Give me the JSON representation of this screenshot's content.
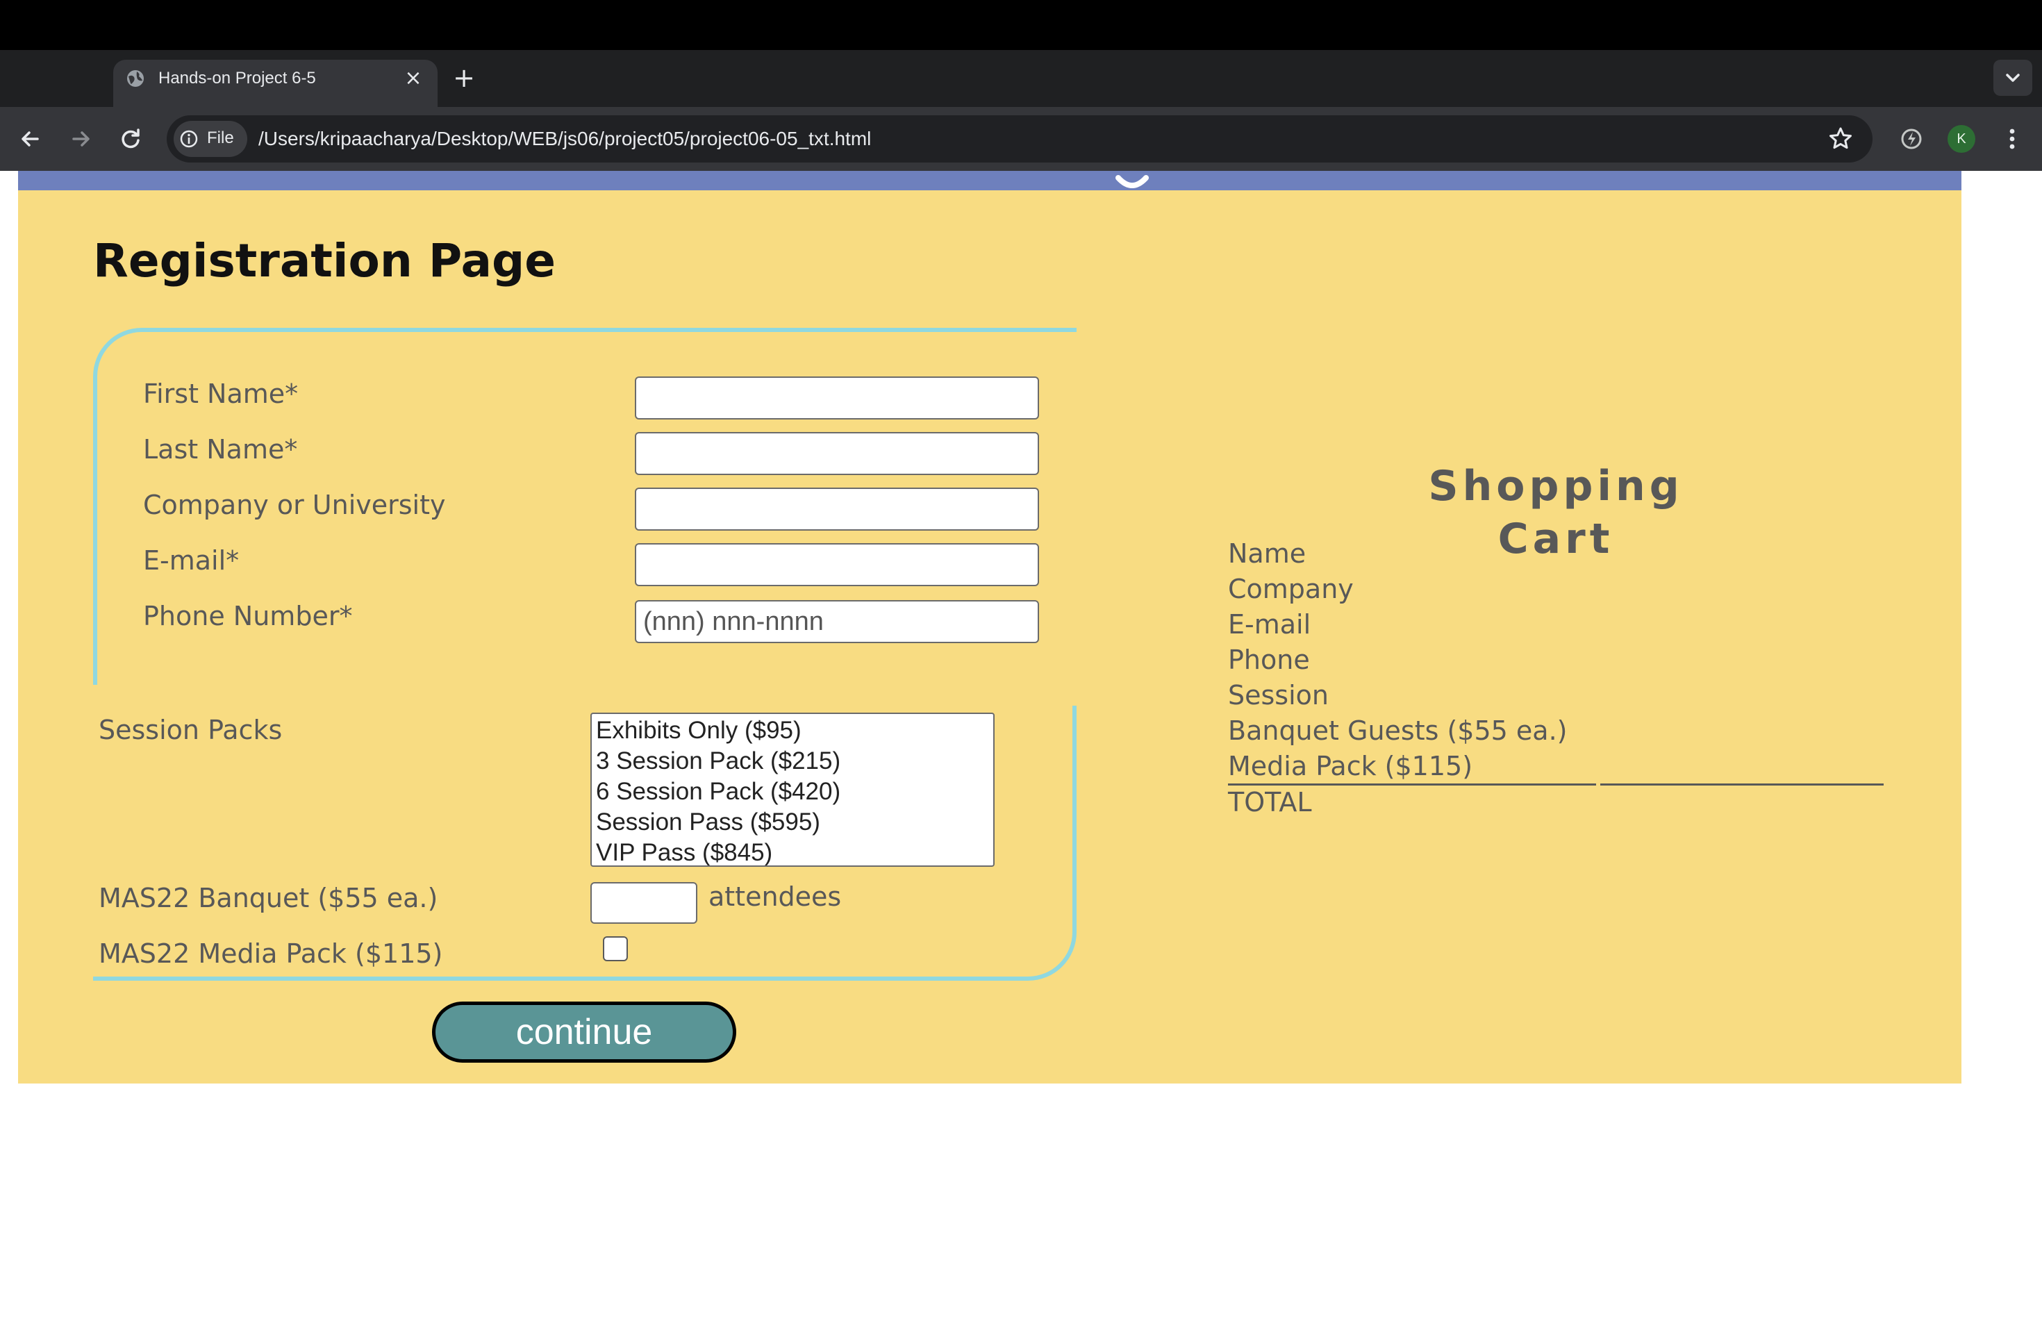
{
  "browser": {
    "tab_title": "Hands-on Project 6-5",
    "tab_close_glyph": "×",
    "new_tab_glyph": "+",
    "site_info_label": "File",
    "url": "/Users/kripaacharya/Desktop/WEB/js06/project05/project06-05_txt.html",
    "profile_initial": "K"
  },
  "page": {
    "title": "Registration Page"
  },
  "form": {
    "fields": [
      {
        "label": "First Name*",
        "value": "",
        "placeholder": ""
      },
      {
        "label": "Last Name*",
        "value": "",
        "placeholder": ""
      },
      {
        "label": "Company or University",
        "value": "",
        "placeholder": ""
      },
      {
        "label": "E-mail*",
        "value": "",
        "placeholder": ""
      },
      {
        "label": "Phone Number*",
        "value": "",
        "placeholder": "(nnn) nnn-nnnn"
      }
    ],
    "session_label": "Session Packs",
    "session_options": [
      "Exhibits Only ($95)",
      "3 Session Pack ($215)",
      "6 Session Pack ($420)",
      "Session Pass ($595)",
      "VIP Pass ($845)"
    ],
    "banquet_label": "MAS22 Banquet ($55 ea.)",
    "banquet_suffix": "attendees",
    "media_label": "MAS22 Media Pack ($115)",
    "media_checked": false,
    "continue_label": "continue"
  },
  "cart": {
    "title": "Shopping Cart",
    "rows": [
      "Name",
      "Company",
      "E-mail",
      "Phone",
      "Session",
      "Banquet Guests ($55 ea.)",
      "Media Pack ($115)",
      "TOTAL"
    ]
  },
  "colors": {
    "page_background": "#f8dc82",
    "header_band": "#6e80bd",
    "fieldset_border": "#8fd8e0",
    "button_fill": "#5a9596",
    "label_text": "#585858"
  },
  "icons": {
    "tab_favicon": "globe-icon",
    "back": "arrow-left-icon",
    "forward": "arrow-right-icon",
    "reload": "reload-icon",
    "site_info": "info-icon",
    "bookmark": "star-icon",
    "extension": "performance-icon",
    "menu": "kebab-menu-icon",
    "tab_list": "chevron-down-icon"
  }
}
